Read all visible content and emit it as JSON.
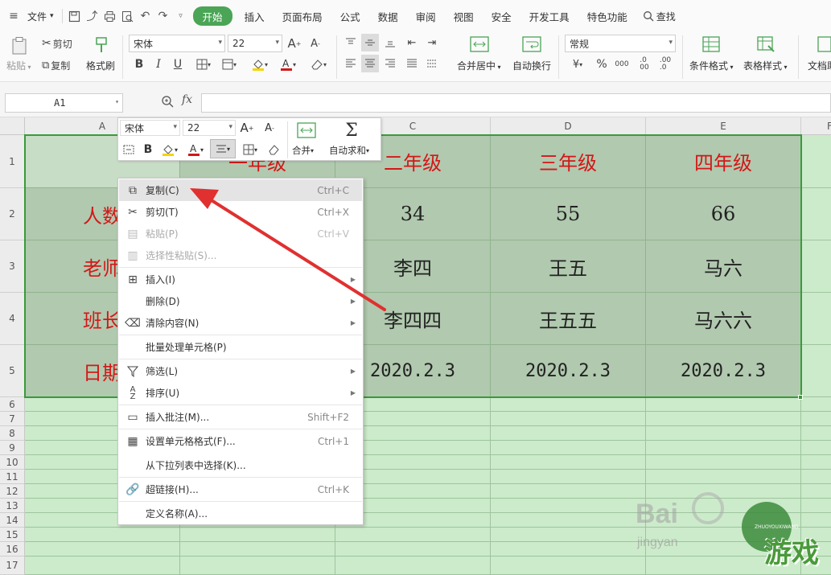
{
  "menubar": {
    "file_label": "文件",
    "tabs": [
      "开始",
      "插入",
      "页面布局",
      "公式",
      "数据",
      "审阅",
      "视图",
      "安全",
      "开发工具",
      "特色功能"
    ],
    "active_tab": "开始",
    "search_label": "查找"
  },
  "ribbon": {
    "paste_label": "粘贴",
    "cut_label": "剪切",
    "copy_label": "复制",
    "format_painter_label": "格式刷",
    "font_name": "宋体",
    "font_size": "22",
    "merge_center_label": "合并居中",
    "wrap_text_label": "自动换行",
    "number_format": "常规",
    "conditional_format_label": "条件格式",
    "table_style_label": "表格样式",
    "doc_helper_label": "文档助"
  },
  "formula_bar": {
    "cell_ref": "A1",
    "fx_label": "fx",
    "value": ""
  },
  "columns": [
    "A",
    "B",
    "C",
    "D",
    "E",
    "F"
  ],
  "rows": [
    "1",
    "2",
    "3",
    "4",
    "5",
    "6",
    "7",
    "8",
    "9",
    "10",
    "11",
    "12",
    "13",
    "14",
    "15",
    "16",
    "17"
  ],
  "cells": {
    "b1": "一年级",
    "c1": "二年级",
    "d1": "三年级",
    "e1": "四年级",
    "a2": "人数",
    "c2": "34",
    "d2": "55",
    "e2": "66",
    "a3": "老师",
    "c3": "李四",
    "d3": "王五",
    "e3": "马六",
    "a4": "班长",
    "c4": "李四四",
    "d4": "王五五",
    "e4": "马六六",
    "a5": "日期",
    "c5": "2020.2.3",
    "d5": "2020.2.3",
    "e5": "2020.2.3"
  },
  "mini_toolbar": {
    "font_name": "宋体",
    "font_size": "22",
    "merge_label": "合并",
    "autosum_label": "自动求和"
  },
  "context_menu": {
    "items": [
      {
        "label": "复制(C)",
        "shortcut": "Ctrl+C"
      },
      {
        "label": "剪切(T)",
        "shortcut": "Ctrl+X"
      },
      {
        "label": "粘贴(P)",
        "shortcut": "Ctrl+V"
      },
      {
        "label": "选择性粘贴(S)...",
        "shortcut": ""
      },
      {
        "label": "插入(I)",
        "shortcut": ""
      },
      {
        "label": "删除(D)",
        "shortcut": ""
      },
      {
        "label": "清除内容(N)",
        "shortcut": ""
      },
      {
        "label": "批量处理单元格(P)",
        "shortcut": ""
      },
      {
        "label": "筛选(L)",
        "shortcut": ""
      },
      {
        "label": "排序(U)",
        "shortcut": ""
      },
      {
        "label": "插入批注(M)...",
        "shortcut": "Shift+F2"
      },
      {
        "label": "设置单元格格式(F)...",
        "shortcut": "Ctrl+1"
      },
      {
        "label": "从下拉列表中选择(K)...",
        "shortcut": ""
      },
      {
        "label": "超链接(H)...",
        "shortcut": "Ctrl+K"
      },
      {
        "label": "定义名称(A)...",
        "shortcut": ""
      }
    ]
  },
  "colors": {
    "accent": "#4aa556",
    "selection_fill": "#b1c9af",
    "grid_fill": "#ccebcb",
    "red_text": "#d21818",
    "arrow": "#e03030"
  },
  "watermark": {
    "text1": "Bai",
    "text2": "jingyan",
    "text3": "游戏",
    "text4": "ZHUOYOUXIWANG"
  }
}
